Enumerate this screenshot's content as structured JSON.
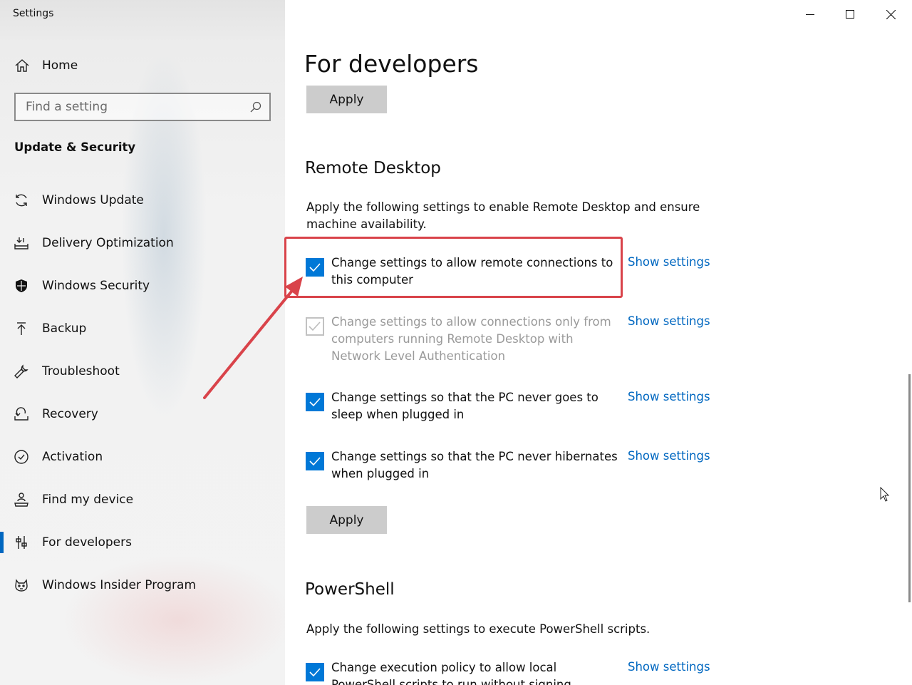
{
  "app": {
    "title": "Settings"
  },
  "window_controls": {
    "minimize_icon": "minimize-icon",
    "maximize_icon": "maximize-icon",
    "close_icon": "close-icon"
  },
  "sidebar": {
    "home_label": "Home",
    "search": {
      "placeholder": "Find a setting",
      "value": ""
    },
    "section_title": "Update & Security",
    "items": [
      {
        "label": "Windows Update",
        "icon": "refresh-icon"
      },
      {
        "label": "Delivery Optimization",
        "icon": "delivery-icon"
      },
      {
        "label": "Windows Security",
        "icon": "shield-icon"
      },
      {
        "label": "Backup",
        "icon": "backup-arrow-icon"
      },
      {
        "label": "Troubleshoot",
        "icon": "wrench-icon"
      },
      {
        "label": "Recovery",
        "icon": "recovery-icon"
      },
      {
        "label": "Activation",
        "icon": "check-circle-icon"
      },
      {
        "label": "Find my device",
        "icon": "person-location-icon"
      },
      {
        "label": "For developers",
        "icon": "developer-sliders-icon",
        "selected": true
      },
      {
        "label": "Windows Insider Program",
        "icon": "insider-cat-icon"
      }
    ],
    "accent_color": "#0067c0"
  },
  "main": {
    "page_title": "For developers",
    "apply_label": "Apply",
    "remote_desktop": {
      "heading": "Remote Desktop",
      "description": "Apply the following settings to enable Remote Desktop and ensure machine availability.",
      "options": [
        {
          "label": "Change settings to allow remote connections to this computer",
          "checked": true,
          "disabled": false,
          "link": "Show settings"
        },
        {
          "label": "Change settings to allow connections only from computers running Remote Desktop with Network Level Authentication",
          "checked": true,
          "disabled": true,
          "link": "Show settings"
        },
        {
          "label": "Change settings so that the PC never goes to sleep when plugged in",
          "checked": true,
          "disabled": false,
          "link": "Show settings"
        },
        {
          "label": "Change settings so that the PC never hibernates when plugged in",
          "checked": true,
          "disabled": false,
          "link": "Show settings"
        }
      ],
      "apply_label": "Apply"
    },
    "powershell": {
      "heading": "PowerShell",
      "description": "Apply the following settings to execute PowerShell scripts.",
      "options": [
        {
          "label": "Change execution policy to allow local PowerShell scripts to run without signing. Require signing for remote scripts.",
          "checked": true,
          "disabled": false,
          "link": "Show settings"
        }
      ]
    },
    "checkbox_color": "#0078d7",
    "link_color": "#0067c0"
  },
  "annotation": {
    "highlight_color": "#d9434a",
    "arrow_icon": "red-arrow"
  }
}
